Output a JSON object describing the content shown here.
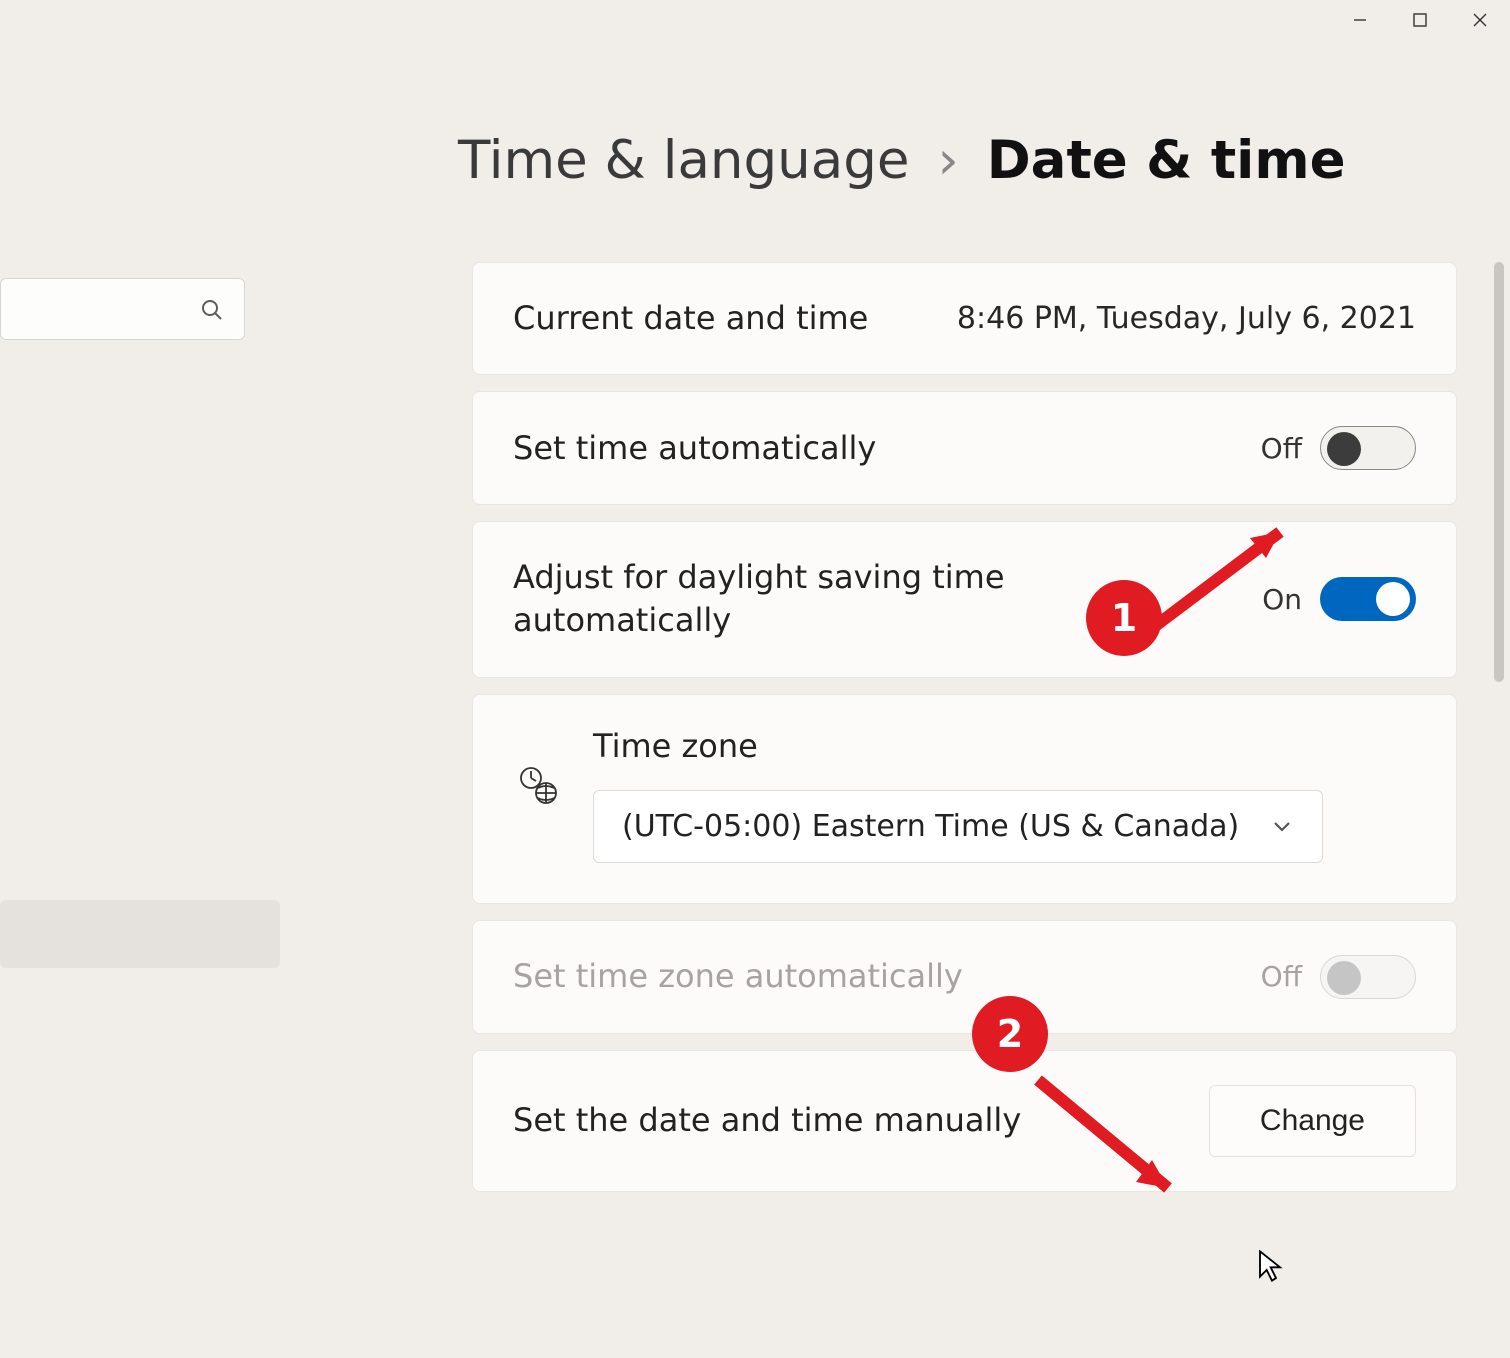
{
  "titlebar": {
    "minimize": "Minimize",
    "maximize": "Maximize",
    "close": "Close"
  },
  "search": {
    "placeholder": ""
  },
  "breadcrumb": {
    "parent": "Time & language",
    "separator": "›",
    "current": "Date & time"
  },
  "cards": {
    "current": {
      "label": "Current date and time",
      "value": "8:46 PM, Tuesday, July 6, 2021"
    },
    "auto_time": {
      "label": "Set time automatically",
      "state": "Off"
    },
    "dst": {
      "label": "Adjust for daylight saving time automatically",
      "state": "On"
    },
    "timezone": {
      "label": "Time zone",
      "value": "(UTC-05:00) Eastern Time (US & Canada)"
    },
    "auto_tz": {
      "label": "Set time zone automatically",
      "state": "Off"
    },
    "manual": {
      "label": "Set the date and time manually",
      "button": "Change"
    }
  },
  "annotations": {
    "badge1": "1",
    "badge2": "2"
  }
}
